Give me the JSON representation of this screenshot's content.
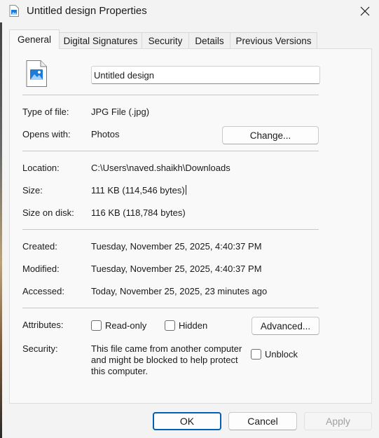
{
  "window": {
    "title": "Untitled design Properties"
  },
  "tabs": [
    {
      "label": "General"
    },
    {
      "label": "Digital Signatures"
    },
    {
      "label": "Security"
    },
    {
      "label": "Details"
    },
    {
      "label": "Previous Versions"
    }
  ],
  "general": {
    "file_name": "Untitled design",
    "type_label": "Type of file:",
    "type_value": "JPG File (.jpg)",
    "opens_label": "Opens with:",
    "opens_value": "Photos",
    "change_label": "Change...",
    "location_label": "Location:",
    "location_value": "C:\\Users\\naved.shaikh\\Downloads",
    "size_label": "Size:",
    "size_value": "111 KB (114,546 bytes)",
    "size_disk_label": "Size on disk:",
    "size_disk_value": "116 KB (118,784 bytes)",
    "created_label": "Created:",
    "created_value": "Tuesday, November 25, 2025, 4:40:37 PM",
    "modified_label": "Modified:",
    "modified_value": "Tuesday, November 25, 2025, 4:40:37 PM",
    "accessed_label": "Accessed:",
    "accessed_value": "Today, November 25, 2025, 23 minutes ago",
    "attributes_label": "Attributes:",
    "readonly_label": "Read-only",
    "hidden_label": "Hidden",
    "advanced_label": "Advanced...",
    "security_label": "Security:",
    "security_text": "This file came from another computer and might be blocked to help protect this computer.",
    "unblock_label": "Unblock"
  },
  "footer": {
    "ok_label": "OK",
    "cancel_label": "Cancel",
    "apply_label": "Apply"
  },
  "colors": {
    "accent": "#005fb8",
    "image_icon": "#1f7ad8"
  },
  "icons": {
    "title": "image-file-icon",
    "close": "close-icon",
    "file": "image-file-icon"
  }
}
